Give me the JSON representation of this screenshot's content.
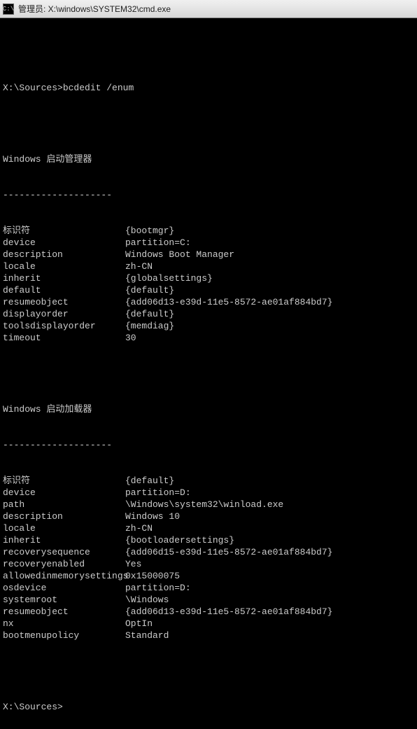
{
  "titlebar": {
    "icon_label": "C:\\",
    "text": "管理员: X:\\windows\\SYSTEM32\\cmd.exe"
  },
  "terminal": {
    "prompt1": "X:\\Sources>",
    "command1": "bcdedit /enum",
    "section1_header": "Windows 启动管理器",
    "divider": "--------------------",
    "section1": [
      {
        "key": "标识符",
        "val": "{bootmgr}"
      },
      {
        "key": "device",
        "val": "partition=C:"
      },
      {
        "key": "description",
        "val": "Windows Boot Manager"
      },
      {
        "key": "locale",
        "val": "zh-CN"
      },
      {
        "key": "inherit",
        "val": "{globalsettings}"
      },
      {
        "key": "default",
        "val": "{default}"
      },
      {
        "key": "resumeobject",
        "val": "{add06d13-e39d-11e5-8572-ae01af884bd7}"
      },
      {
        "key": "displayorder",
        "val": "{default}"
      },
      {
        "key": "toolsdisplayorder",
        "val": "{memdiag}"
      },
      {
        "key": "timeout",
        "val": "30"
      }
    ],
    "section2_header": "Windows 启动加载器",
    "section2": [
      {
        "key": "标识符",
        "val": "{default}"
      },
      {
        "key": "device",
        "val": "partition=D:"
      },
      {
        "key": "path",
        "val": "\\Windows\\system32\\winload.exe"
      },
      {
        "key": "description",
        "val": "Windows 10"
      },
      {
        "key": "locale",
        "val": "zh-CN"
      },
      {
        "key": "inherit",
        "val": "{bootloadersettings}"
      },
      {
        "key": "recoverysequence",
        "val": "{add06d15-e39d-11e5-8572-ae01af884bd7}"
      },
      {
        "key": "recoveryenabled",
        "val": "Yes"
      },
      {
        "key": "allowedinmemorysettings",
        "val": "0x15000075"
      },
      {
        "key": "osdevice",
        "val": "partition=D:"
      },
      {
        "key": "systemroot",
        "val": "\\Windows"
      },
      {
        "key": "resumeobject",
        "val": "{add06d13-e39d-11e5-8572-ae01af884bd7}"
      },
      {
        "key": "nx",
        "val": "OptIn"
      },
      {
        "key": "bootmenupolicy",
        "val": "Standard"
      }
    ],
    "prompt2": "X:\\Sources>"
  }
}
